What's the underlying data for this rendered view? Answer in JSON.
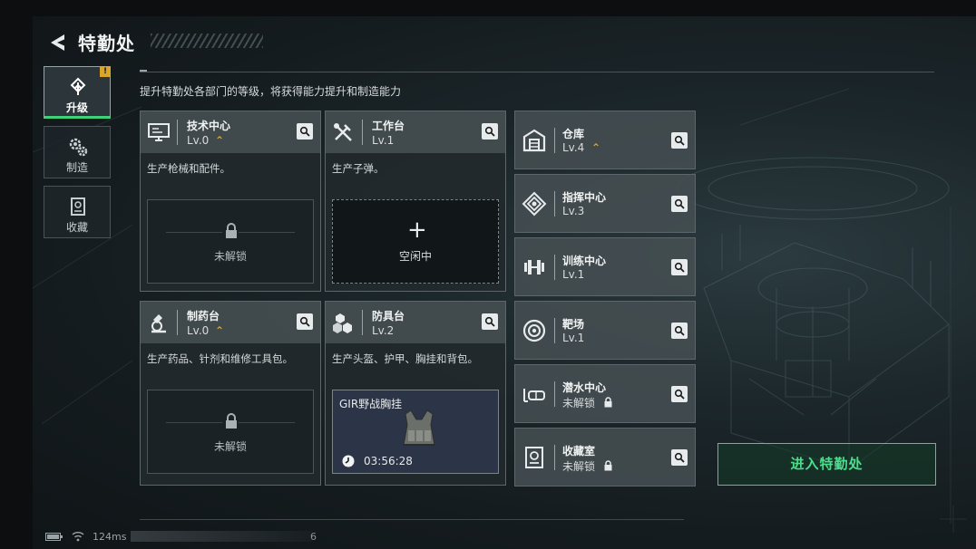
{
  "header": {
    "title": "特勤处"
  },
  "nav": [
    {
      "label": "升级",
      "icon": "upgrade-icon",
      "badge": "!"
    },
    {
      "label": "制造",
      "icon": "gears-icon"
    },
    {
      "label": "收藏",
      "icon": "collection-icon"
    }
  ],
  "description": "提升特勤处各部门的等级，将获得能力提升和制造能力",
  "cards": {
    "tech": {
      "name": "技术中心",
      "level": "Lv.0",
      "upgradable": true,
      "desc": "生产枪械和配件。",
      "slot_label": "未解锁",
      "icon": "monitor-icon"
    },
    "workbench": {
      "name": "工作台",
      "level": "Lv.1",
      "desc": "生产子弹。",
      "slot_label": "空闲中",
      "icon": "tools-icon"
    },
    "pharmacy": {
      "name": "制药台",
      "level": "Lv.0",
      "upgradable": true,
      "desc": "生产药品、针剂和维修工具包。",
      "slot_label": "未解锁",
      "icon": "microscope-icon"
    },
    "armor": {
      "name": "防具台",
      "level": "Lv.2",
      "desc": "生产头盔、护甲、胸挂和背包。",
      "icon": "blocks-icon",
      "item": {
        "name": "GIR野战胸挂",
        "timer": "03:56:28",
        "icon": "chest-rig-icon"
      }
    }
  },
  "side_cards": [
    {
      "name": "仓库",
      "level": "Lv.4",
      "upgradable": true,
      "icon": "warehouse-icon"
    },
    {
      "name": "指挥中心",
      "level": "Lv.3",
      "icon": "command-icon"
    },
    {
      "name": "训练中心",
      "level": "Lv.1",
      "icon": "dumbbell-icon"
    },
    {
      "name": "靶场",
      "level": "Lv.1",
      "icon": "target-icon"
    },
    {
      "name": "潜水中心",
      "level": "未解锁",
      "locked": true,
      "icon": "diving-mask-icon"
    },
    {
      "name": "收藏室",
      "level": "未解锁",
      "locked": true,
      "icon": "vault-icon"
    }
  ],
  "enter_button": "进入特勤处",
  "status": {
    "ping": "124ms",
    "trail_number": "6"
  },
  "colors": {
    "accent_green": "#3fd07a",
    "upgrade_gold": "#d9a52b",
    "card_header": "#464f53"
  }
}
